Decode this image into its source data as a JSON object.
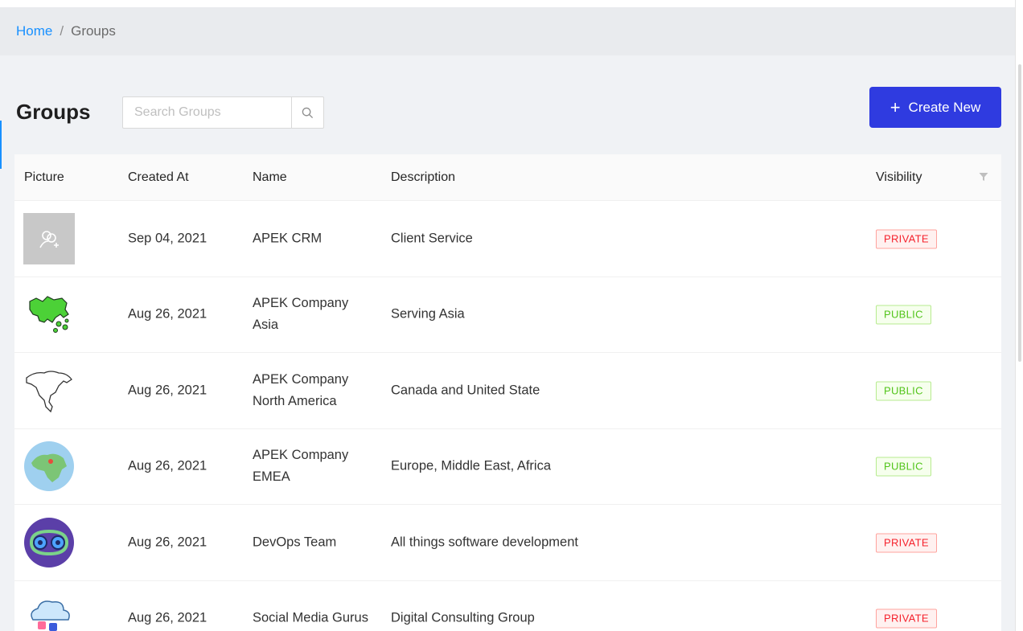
{
  "breadcrumb": {
    "home": "Home",
    "separator": "/",
    "current": "Groups"
  },
  "page": {
    "title": "Groups"
  },
  "search": {
    "placeholder": "Search Groups",
    "value": ""
  },
  "create_button": {
    "label": "Create New",
    "icon": "plus-icon"
  },
  "table": {
    "headers": {
      "picture": "Picture",
      "created_at": "Created At",
      "name": "Name",
      "description": "Description",
      "visibility": "Visibility"
    },
    "rows": [
      {
        "picture": "default-group-icon",
        "created_at": "Sep 04, 2021",
        "name": "APEK CRM",
        "description": "Client Service",
        "visibility": "PRIVATE"
      },
      {
        "picture": "asia-map-image",
        "created_at": "Aug 26, 2021",
        "name": "APEK Company Asia",
        "description": "Serving Asia",
        "visibility": "PUBLIC"
      },
      {
        "picture": "north-america-map-image",
        "created_at": "Aug 26, 2021",
        "name": "APEK Company North America",
        "description": "Canada and United State",
        "visibility": "PUBLIC"
      },
      {
        "picture": "emea-globe-image",
        "created_at": "Aug 26, 2021",
        "name": "APEK Company EMEA",
        "description": "Europe, Middle East, Africa",
        "visibility": "PUBLIC"
      },
      {
        "picture": "devops-gears-image",
        "created_at": "Aug 26, 2021",
        "name": "DevOps Team",
        "description": "All things software development",
        "visibility": "PRIVATE"
      },
      {
        "picture": "social-cloud-image",
        "created_at": "Aug 26, 2021",
        "name": "Social Media Gurus",
        "description": "Digital Consulting Group",
        "visibility": "PRIVATE"
      }
    ]
  },
  "colors": {
    "primary": "#2f3be0",
    "link": "#1890ff",
    "private": "#f5222d",
    "public": "#52c41a"
  }
}
